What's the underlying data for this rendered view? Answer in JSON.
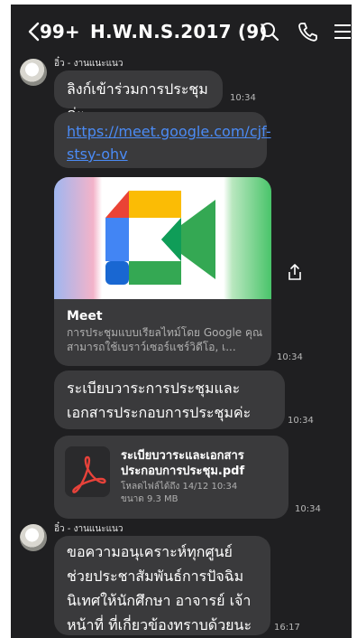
{
  "header": {
    "back_count": "99+",
    "title": "H.W.N.S.2017 (9)"
  },
  "messages": {
    "sender_1": "อิ๋ว - งานแนะแนว",
    "msg1_text": "ลิงก์เข้าร่วมการประชุมค่ะ",
    "msg1_time": "10:34",
    "link_url": "https://meet.google.com/cjf-stsy-ohv",
    "preview": {
      "title": "Meet",
      "description": "การประชุมแบบเรียลไทม์โดย Google คุณสามารถใช้เบราว์เซอร์แชร์วิดีโอ, เ...",
      "time": "10:34"
    },
    "msg3_text": "ระเบียบวาระการประชุมและเอกสารประกอบการประชุมค่ะ",
    "msg3_time": "10:34",
    "file": {
      "name": "ระเบียบวาระและเอกสารประกอบการประชุม.pdf",
      "expiry": "โหลดไฟล์ได้ถึง 14/12 10:34",
      "size": "ขนาด 9.3 MB",
      "time": "10:34"
    },
    "sender_2": "อิ๋ว - งานแนะแนว",
    "msg5_text": "ขอความอนุเคราะห์ทุกศูนย์ช่วยประชาสัมพันธ์การปัจฉิมนิเทศให้นักศึกษา อาจารย์ เจ้าหน้าที่ ที่เกี่ยวข้องทราบด้วยนะคะ",
    "msg5_time": "16:17"
  },
  "colors": {
    "background": "#1f1f21",
    "bubble": "#3a3a3c",
    "link": "#4b8bf5",
    "pdf_red": "#e8423a"
  }
}
